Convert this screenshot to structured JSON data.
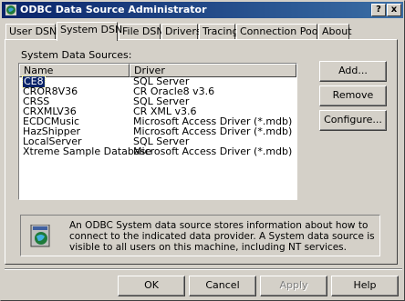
{
  "window": {
    "title": "ODBC Data Source Administrator",
    "help_btn": "?",
    "close_btn": "x"
  },
  "tabs": [
    "User DSN",
    "System DSN",
    "File DSN",
    "Drivers",
    "Tracing",
    "Connection Pooling",
    "About"
  ],
  "active_tab": "System DSN",
  "list_label": "System Data Sources:",
  "columns": [
    "Name",
    "Driver"
  ],
  "rows": [
    {
      "name": "CE8",
      "driver": "SQL Server"
    },
    {
      "name": "CROR8V36",
      "driver": "CR Oracle8 v3.6"
    },
    {
      "name": "CRSS",
      "driver": "SQL Server"
    },
    {
      "name": "CRXMLV36",
      "driver": "CR XML v3.6"
    },
    {
      "name": "ECDCMusic",
      "driver": "Microsoft Access Driver (*.mdb)"
    },
    {
      "name": "HazShipper",
      "driver": "Microsoft Access Driver (*.mdb)"
    },
    {
      "name": "LocalServer",
      "driver": "SQL Server"
    },
    {
      "name": "Xtreme Sample Database",
      "driver": "Microsoft Access Driver (*.mdb)"
    }
  ],
  "selected_row": "CE8",
  "side_buttons": {
    "add": "Add...",
    "remove": "Remove",
    "configure": "Configure..."
  },
  "info_text": "An ODBC System data source stores information about how to connect to the indicated data provider.  A System data source is visible to all users on this machine, including NT services.",
  "footer_buttons": {
    "ok": "OK",
    "cancel": "Cancel",
    "apply": "Apply",
    "help": "Help"
  },
  "colors": {
    "titlebar_start": "#0a246a",
    "titlebar_end": "#3a6ea5",
    "face": "#d4d0c8",
    "selection": "#0a246a"
  }
}
